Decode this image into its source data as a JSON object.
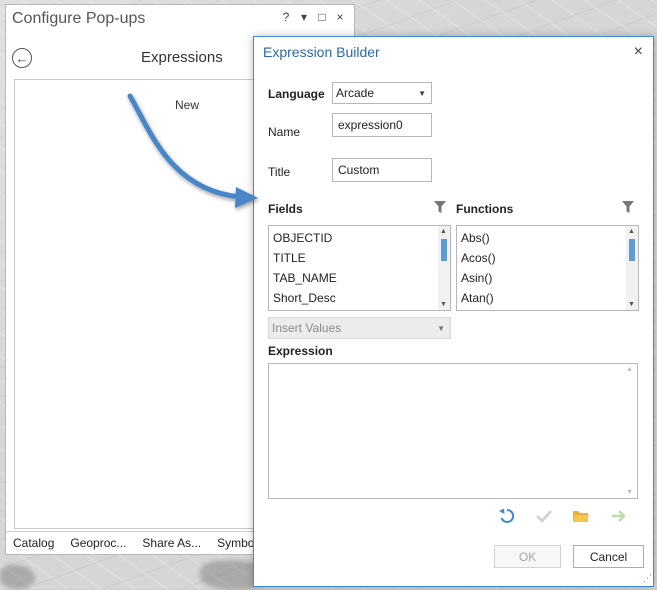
{
  "pane": {
    "title": "Configure Pop-ups",
    "ctrl_help": "?",
    "ctrl_menu": "▾",
    "ctrl_restore": "□",
    "ctrl_close": "×",
    "heading": "Expressions",
    "new_label": "New",
    "tabs": [
      "Catalog",
      "Geoproc...",
      "Share As...",
      "Symbolo"
    ]
  },
  "dialog": {
    "title": "Expression Builder",
    "close": "×",
    "language_label": "Language",
    "language_value": "Arcade",
    "name_label": "Name",
    "name_value": "expression0",
    "title_label": "Title",
    "title_value": "Custom",
    "fields_label": "Fields",
    "functions_label": "Functions",
    "fields": [
      "OBJECTID",
      "TITLE",
      "TAB_NAME",
      "Short_Desc"
    ],
    "functions": [
      "Abs()",
      "Acos()",
      "Asin()",
      "Atan()"
    ],
    "insert_values": "Insert Values",
    "expression_label": "Expression",
    "ok_label": "OK",
    "cancel_label": "Cancel"
  },
  "colors": {
    "accent": "#3e8ad2",
    "title_blue": "#2a6aa8",
    "arrow": "#4a86c8"
  }
}
